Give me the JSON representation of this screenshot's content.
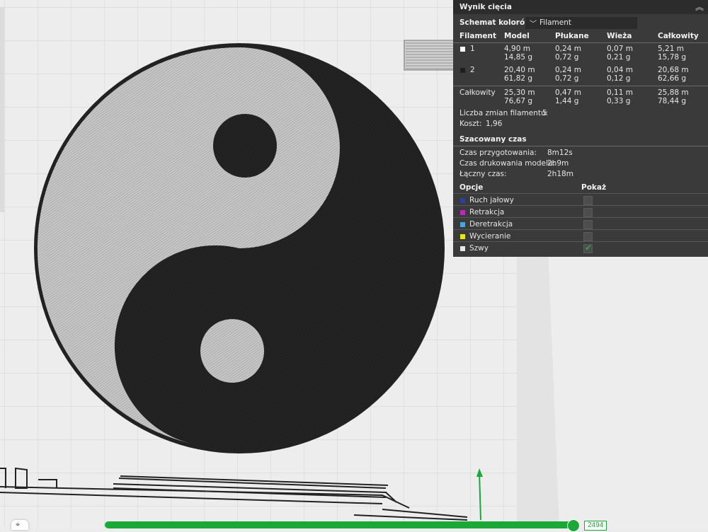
{
  "panel": {
    "title": "Wynik cięcia",
    "collapse_icon": "double-chevron-up-icon",
    "color_scheme_label": "Schemat kolorów",
    "color_scheme_value": "Filament",
    "headers": [
      "Filament",
      "Model",
      "Płukane",
      "Wieża",
      "Całkowity"
    ],
    "filaments": [
      {
        "id": "1",
        "color": "#ffffff",
        "model": [
          "4,90 m",
          "14,85 g"
        ],
        "flush": [
          "0,24 m",
          "0,72 g"
        ],
        "tower": [
          "0,07 m",
          "0,21 g"
        ],
        "total": [
          "5,21 m",
          "15,78 g"
        ]
      },
      {
        "id": "2",
        "color": "#1e1e1e",
        "model": [
          "20,40 m",
          "61,82 g"
        ],
        "flush": [
          "0,24 m",
          "0,72 g"
        ],
        "tower": [
          "0,04 m",
          "0,12 g"
        ],
        "total": [
          "20,68 m",
          "62,66 g"
        ]
      }
    ],
    "total": {
      "label": "Całkowity",
      "model": [
        "25,30 m",
        "76,67 g"
      ],
      "flush": [
        "0,47 m",
        "1,44 g"
      ],
      "tower": [
        "0,11 m",
        "0,33 g"
      ],
      "total": [
        "25,88 m",
        "78,44 g"
      ]
    },
    "filament_changes_label": "Liczba zmian filamentu:",
    "filament_changes_value": "5",
    "cost_label": "Koszt:",
    "cost_value": "1,96",
    "time_header": "Szacowany czas",
    "prep_label": "Czas przygotowania:",
    "prep_value": "8m12s",
    "model_time_label": "Czas drukowania modelu:",
    "model_time_value": "2h9m",
    "total_time_label": "Łączny czas:",
    "total_time_value": "2h18m",
    "options_header": "Opcje",
    "show_header": "Pokaż",
    "options": [
      {
        "label": "Ruch jałowy",
        "color": "#2f3f9c",
        "checked": false
      },
      {
        "label": "Retrakcja",
        "color": "#c126c5",
        "checked": false
      },
      {
        "label": "Deretrakcja",
        "color": "#4aa6d8",
        "checked": false
      },
      {
        "label": "Wycieranie",
        "color": "#e8e817",
        "checked": false
      },
      {
        "label": "Szwy",
        "color": "#e8e8e8",
        "checked": true
      }
    ]
  },
  "viewport": {
    "layer_value": "2494",
    "layer_progress": 1.0,
    "accent_color": "#1aa836",
    "camera_icon": "camera-view-icon",
    "axis_icon": "y-axis-arrow-icon"
  }
}
